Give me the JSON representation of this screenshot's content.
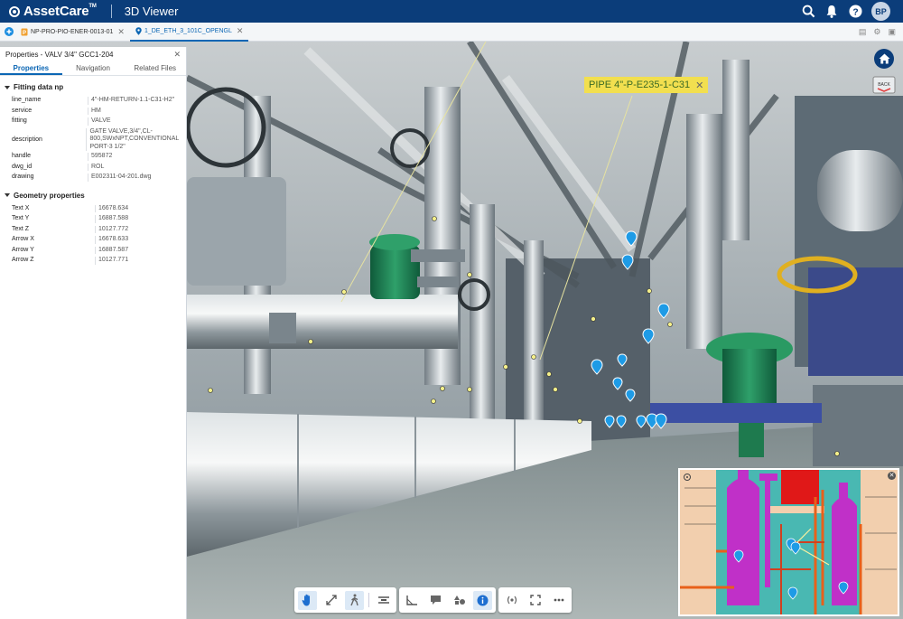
{
  "app": {
    "brand": "AssetCare",
    "brand_tm": "TM",
    "module": "3D Viewer",
    "user_initials": "BP"
  },
  "tabs": [
    {
      "label": "NP-PRO-PIO-ENER-0013-01",
      "active": false
    },
    {
      "label": "1_DE_ETH_3_101C_OPENGL",
      "active": true
    }
  ],
  "panel": {
    "title": "Properties - VALV 3/4\" GCC1-204",
    "tabs": [
      "Properties",
      "Navigation",
      "Related Files"
    ],
    "fitting_title": "Fitting data np",
    "fitting": [
      {
        "key": "line_name",
        "value": "4\"-HM-RETURN-1.1-C31-H2\""
      },
      {
        "key": "service",
        "value": "HM"
      },
      {
        "key": "fitting",
        "value": "VALVE"
      },
      {
        "key": "description",
        "value": "GATE VALVE,3/4\",CL-800,SWxNPT,CONVENTIONAL PORT-3 1/2\""
      },
      {
        "key": "handle",
        "value": "595872"
      },
      {
        "key": "dwg_id",
        "value": "ROL"
      },
      {
        "key": "drawing",
        "value": "E002311-04-201.dwg"
      }
    ],
    "geometry_title": "Geometry properties",
    "geometry": [
      {
        "key": "Text X",
        "value": "16678.634"
      },
      {
        "key": "Text Y",
        "value": "16887.588"
      },
      {
        "key": "Text Z",
        "value": "10127.772"
      },
      {
        "key": "Arrow X",
        "value": "16678.633"
      },
      {
        "key": "Arrow Y",
        "value": "16887.587"
      },
      {
        "key": "Arrow Z",
        "value": "10127.771"
      }
    ]
  },
  "callout": {
    "label": "PIPE 4\"-P-E235-1-C31"
  },
  "back_label": "BACK",
  "colors": {
    "brand": "#0b3d7a",
    "accent": "#0b66b4",
    "callout": "#f2df4f",
    "marker": "#1e9be6",
    "hotspot": "#f5f08a"
  }
}
